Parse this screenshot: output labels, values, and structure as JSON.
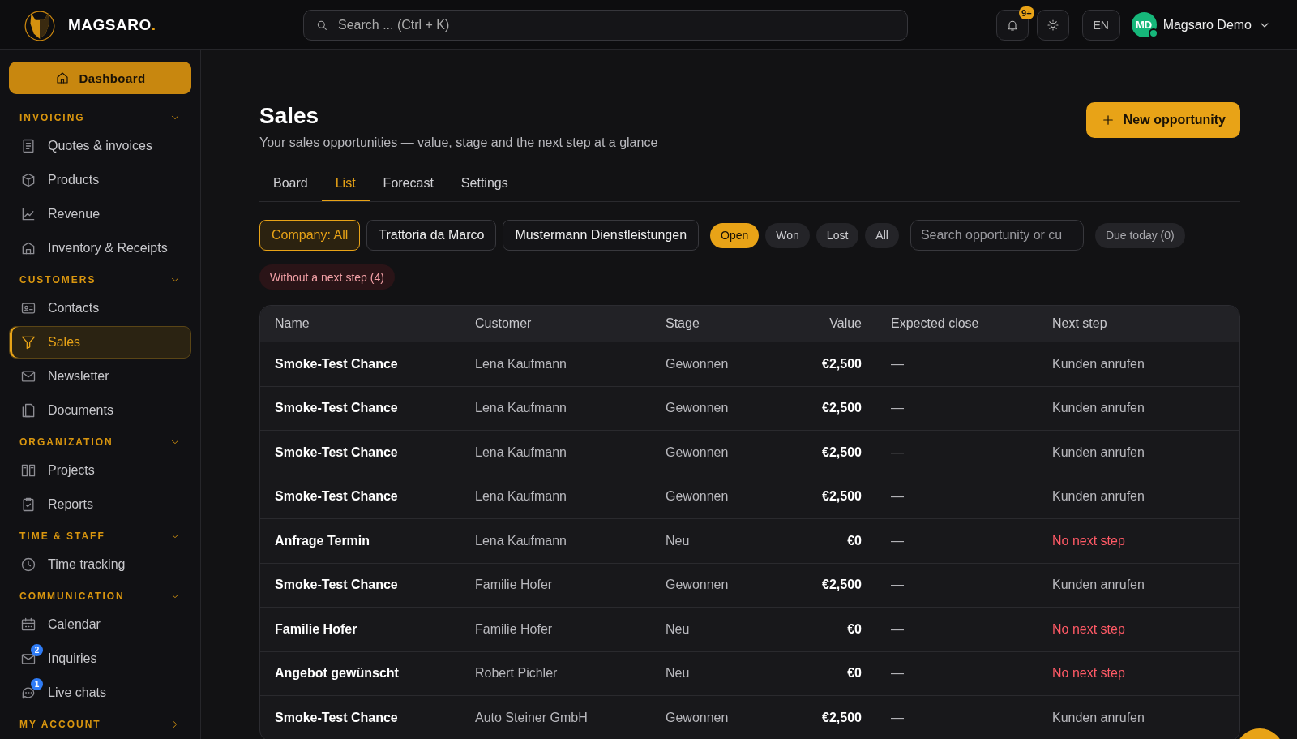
{
  "brand": {
    "name": "MAGSARO",
    "dot": "."
  },
  "search": {
    "placeholder": "Search ... (Ctrl + K)"
  },
  "topbar": {
    "notifications_badge": "9+",
    "language": "EN",
    "user": {
      "initials": "MD",
      "name": "Magsaro Demo",
      "online": true
    }
  },
  "sidebar": {
    "dashboard": {
      "label": "Dashboard",
      "selected": true
    },
    "sections": [
      {
        "title": "INVOICING",
        "expanded": true,
        "items": [
          {
            "label": "Quotes & invoices",
            "selected": false
          },
          {
            "label": "Products",
            "selected": false
          },
          {
            "label": "Revenue",
            "selected": false
          },
          {
            "label": "Inventory & Receipts",
            "selected": false
          }
        ]
      },
      {
        "title": "CUSTOMERS",
        "expanded": true,
        "items": [
          {
            "label": "Contacts",
            "selected": false
          },
          {
            "label": "Sales",
            "selected": true
          },
          {
            "label": "Newsletter",
            "selected": false
          },
          {
            "label": "Documents",
            "selected": false
          }
        ]
      },
      {
        "title": "ORGANIZATION",
        "expanded": true,
        "items": [
          {
            "label": "Projects",
            "selected": false
          },
          {
            "label": "Reports",
            "selected": false
          }
        ]
      },
      {
        "title": "TIME & STAFF",
        "expanded": true,
        "items": [
          {
            "label": "Time tracking",
            "selected": false
          }
        ]
      },
      {
        "title": "COMMUNICATION",
        "expanded": true,
        "items": [
          {
            "label": "Calendar",
            "selected": false
          },
          {
            "label": "Inquiries",
            "selected": false,
            "badge": "2"
          },
          {
            "label": "Live chats",
            "selected": false,
            "badge": "1"
          }
        ]
      },
      {
        "title": "MY ACCOUNT",
        "expanded": false
      }
    ]
  },
  "page": {
    "title": "Sales",
    "subtitle": "Your sales opportunities — value, stage and the next step at a glance",
    "new_button": "New opportunity"
  },
  "tabs": [
    {
      "label": "Board",
      "selected": false
    },
    {
      "label": "List",
      "selected": true
    },
    {
      "label": "Forecast",
      "selected": false
    },
    {
      "label": "Settings",
      "selected": false
    }
  ],
  "company_filters": [
    {
      "label": "Company: All",
      "selected": true
    },
    {
      "label": "Trattoria da Marco",
      "selected": false
    },
    {
      "label": "Mustermann Dienstleistungen",
      "selected": false
    }
  ],
  "status_filters": [
    {
      "label": "Open",
      "selected": true
    },
    {
      "label": "Won",
      "selected": false
    },
    {
      "label": "Lost",
      "selected": false
    },
    {
      "label": "All",
      "selected": false
    }
  ],
  "opportunity_search": {
    "placeholder": "Search opportunity or cu"
  },
  "due_today": {
    "label": "Due today (0)",
    "selected": false
  },
  "without_next_step": {
    "label": "Without a next step (4)",
    "selected": false
  },
  "table": {
    "columns": [
      "Name",
      "Customer",
      "Stage",
      "Value",
      "Expected close",
      "Next step"
    ],
    "rows": [
      {
        "name": "Smoke-Test Chance",
        "customer": "Lena Kaufmann",
        "stage": "Gewonnen",
        "value": "€2,500",
        "close": "—",
        "next_step": "Kunden anrufen",
        "missing": false
      },
      {
        "name": "Smoke-Test Chance",
        "customer": "Lena Kaufmann",
        "stage": "Gewonnen",
        "value": "€2,500",
        "close": "—",
        "next_step": "Kunden anrufen",
        "missing": false
      },
      {
        "name": "Smoke-Test Chance",
        "customer": "Lena Kaufmann",
        "stage": "Gewonnen",
        "value": "€2,500",
        "close": "—",
        "next_step": "Kunden anrufen",
        "missing": false
      },
      {
        "name": "Smoke-Test Chance",
        "customer": "Lena Kaufmann",
        "stage": "Gewonnen",
        "value": "€2,500",
        "close": "—",
        "next_step": "Kunden anrufen",
        "missing": false
      },
      {
        "name": "Anfrage Termin",
        "customer": "Lena Kaufmann",
        "stage": "Neu",
        "value": "€0",
        "close": "—",
        "next_step": "No next step",
        "missing": true
      },
      {
        "name": "Smoke-Test Chance",
        "customer": "Familie Hofer",
        "stage": "Gewonnen",
        "value": "€2,500",
        "close": "—",
        "next_step": "Kunden anrufen",
        "missing": false
      },
      {
        "name": "Familie Hofer",
        "customer": "Familie Hofer",
        "stage": "Neu",
        "value": "€0",
        "close": "—",
        "next_step": "No next step",
        "missing": true
      },
      {
        "name": "Angebot gewünscht",
        "customer": "Robert Pichler",
        "stage": "Neu",
        "value": "€0",
        "close": "—",
        "next_step": "No next step",
        "missing": true
      },
      {
        "name": "Smoke-Test Chance",
        "customer": "Auto Steiner GmbH",
        "stage": "Gewonnen",
        "value": "€2,500",
        "close": "—",
        "next_step": "Kunden anrufen",
        "missing": false
      }
    ]
  }
}
